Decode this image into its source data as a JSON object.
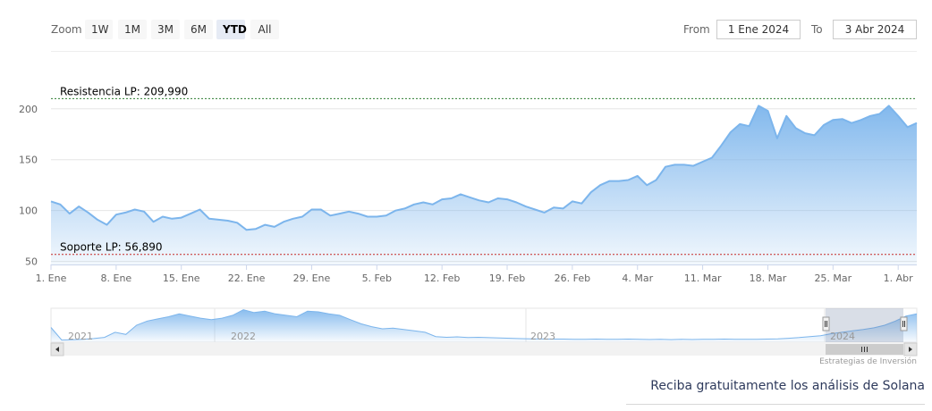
{
  "toolbar": {
    "zoom_label": "Zoom",
    "buttons": [
      "1W",
      "1M",
      "3M",
      "6M",
      "YTD",
      "All"
    ],
    "active": "YTD",
    "from_label": "From",
    "from_value": "1 Ene 2024",
    "to_label": "To",
    "to_value": "3 Abr 2024"
  },
  "chart_data": {
    "type": "area",
    "title": "",
    "xlabel": "",
    "ylabel": "",
    "x": [
      "1 Ene",
      "2 Ene",
      "3 Ene",
      "4 Ene",
      "5 Ene",
      "6 Ene",
      "7 Ene",
      "8 Ene",
      "9 Ene",
      "10 Ene",
      "11 Ene",
      "12 Ene",
      "13 Ene",
      "14 Ene",
      "15 Ene",
      "16 Ene",
      "17 Ene",
      "18 Ene",
      "19 Ene",
      "20 Ene",
      "21 Ene",
      "22 Ene",
      "23 Ene",
      "24 Ene",
      "25 Ene",
      "26 Ene",
      "27 Ene",
      "28 Ene",
      "29 Ene",
      "30 Ene",
      "31 Ene",
      "1 Feb",
      "2 Feb",
      "3 Feb",
      "4 Feb",
      "5 Feb",
      "6 Feb",
      "7 Feb",
      "8 Feb",
      "9 Feb",
      "10 Feb",
      "11 Feb",
      "12 Feb",
      "13 Feb",
      "14 Feb",
      "15 Feb",
      "16 Feb",
      "17 Feb",
      "18 Feb",
      "19 Feb",
      "20 Feb",
      "21 Feb",
      "22 Feb",
      "23 Feb",
      "24 Feb",
      "25 Feb",
      "26 Feb",
      "27 Feb",
      "28 Feb",
      "29 Feb",
      "1 Mar",
      "2 Mar",
      "3 Mar",
      "4 Mar",
      "5 Mar",
      "6 Mar",
      "7 Mar",
      "8 Mar",
      "9 Mar",
      "10 Mar",
      "11 Mar",
      "12 Mar",
      "13 Mar",
      "14 Mar",
      "15 Mar",
      "16 Mar",
      "17 Mar",
      "18 Mar",
      "19 Mar",
      "20 Mar",
      "21 Mar",
      "22 Mar",
      "23 Mar",
      "24 Mar",
      "25 Mar",
      "26 Mar",
      "27 Mar",
      "28 Mar",
      "29 Mar",
      "30 Mar",
      "31 Mar",
      "1 Abr",
      "2 Abr",
      "3 Abr"
    ],
    "values": [
      109,
      106,
      97,
      104,
      98,
      91,
      86,
      96,
      98,
      101,
      99,
      89,
      94,
      92,
      93,
      97,
      101,
      92,
      91,
      90,
      88,
      81,
      82,
      86,
      84,
      89,
      92,
      94,
      101,
      101,
      95,
      97,
      99,
      97,
      94,
      94,
      95,
      100,
      102,
      106,
      108,
      106,
      111,
      112,
      116,
      113,
      110,
      108,
      112,
      111,
      108,
      104,
      101,
      98,
      103,
      102,
      109,
      107,
      118,
      125,
      129,
      129,
      130,
      134,
      125,
      130,
      143,
      145,
      145,
      144,
      148,
      152,
      164,
      177,
      185,
      183,
      203,
      198,
      171,
      193,
      181,
      176,
      174,
      184,
      189,
      190,
      186,
      189,
      193,
      195,
      203,
      193,
      182,
      186
    ],
    "ylim": [
      47,
      213
    ],
    "yticks": [
      50,
      100,
      150,
      200
    ],
    "xticks": [
      {
        "label": "1. Ene",
        "index": 0
      },
      {
        "label": "8. Ene",
        "index": 7
      },
      {
        "label": "15. Ene",
        "index": 14
      },
      {
        "label": "22. Ene",
        "index": 21
      },
      {
        "label": "29. Ene",
        "index": 28
      },
      {
        "label": "5. Feb",
        "index": 35
      },
      {
        "label": "12. Feb",
        "index": 42
      },
      {
        "label": "19. Feb",
        "index": 49
      },
      {
        "label": "26. Feb",
        "index": 56
      },
      {
        "label": "4. Mar",
        "index": 63
      },
      {
        "label": "11. Mar",
        "index": 70
      },
      {
        "label": "18. Mar",
        "index": 77
      },
      {
        "label": "25. Mar",
        "index": 84
      },
      {
        "label": "1. Abr",
        "index": 91
      }
    ],
    "grid": true,
    "plot_lines": [
      {
        "label": "Resistencia LP: 209,990",
        "value": 209.99,
        "color": "#2e7d32"
      },
      {
        "label": "Soporte LP: 56,890",
        "value": 56.89,
        "color": "#c62828"
      }
    ],
    "series_color": "#7cb5ec"
  },
  "navigator": {
    "years": [
      "2021",
      "2022",
      "2023",
      "2024"
    ],
    "values": [
      104,
      15,
      17,
      21,
      26,
      34,
      70,
      55,
      120,
      150,
      165,
      180,
      200,
      185,
      170,
      160,
      170,
      190,
      230,
      210,
      220,
      200,
      190,
      180,
      220,
      215,
      200,
      190,
      160,
      130,
      110,
      95,
      100,
      90,
      80,
      70,
      40,
      35,
      38,
      33,
      35,
      32,
      30,
      28,
      25,
      24,
      23,
      22,
      22,
      21,
      21,
      22,
      20,
      21,
      22,
      20,
      19,
      20,
      18,
      20,
      19,
      20,
      21,
      22,
      21,
      20,
      21,
      22,
      24,
      28,
      33,
      40,
      46,
      60,
      70,
      80,
      90,
      102,
      120,
      150,
      185,
      200
    ]
  },
  "credit": "Estrategias de Inversión",
  "cta": "Reciba gratuitamente los análisis de Solana"
}
